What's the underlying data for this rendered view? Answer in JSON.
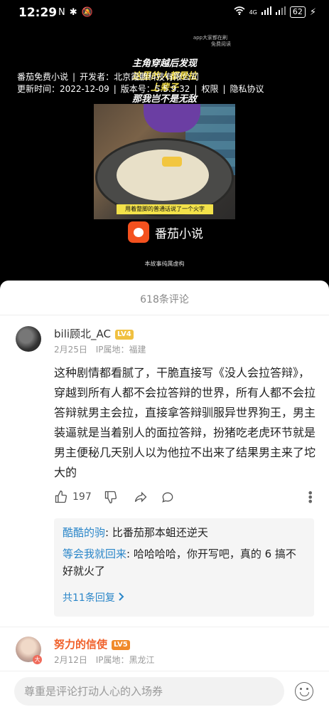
{
  "status_bar": {
    "time": "12:29",
    "left_icons": [
      "N",
      "✱",
      "🔕"
    ],
    "signal": "4G",
    "battery": "62"
  },
  "video": {
    "caption_line1": "主角穿越后发现",
    "caption_line2": "这里的人都是拉",
    "caption_line3": "上辈子",
    "caption_line4": "那我岂不是无敌",
    "subtitle": "用着蹩脚的普通话说了一个火字",
    "watermark1": "app大家都在刷",
    "watermark2": "免费阅读",
    "brand_name": "番茄小说",
    "brand_sub": "本故事纯属虚构",
    "app_info": {
      "app_name": "番茄免费小说",
      "developer": "开发者：北京霞鹏科技有限公司",
      "updated": "更新时间：2022-12-09",
      "version": "版本号：5.5.9.32",
      "permissions": "权限",
      "privacy": "隐私协议",
      "separator": "|"
    }
  },
  "comments": {
    "title": "618条评论",
    "items": [
      {
        "name": "bili顾北_AC",
        "level": "LV4",
        "date": "2月25日",
        "ip": "IP属地：福建",
        "body": "这种剧情都看腻了，干脆直接写《没人会拉答辩》，穿越到所有人都不会拉答辩的世界，所有人都不会拉答辩就男主会拉，直接拿答辩驯服异世界狗王，男主装逼就是当着别人的面拉答辩，扮猪吃老虎环节就是男主便秘几天别人以为他拉不出来了结果男主来了坨大的",
        "likes": "197"
      },
      {
        "name": "努力的信使",
        "level": "LV5",
        "date": "2月12日",
        "ip": "IP属地：黑龙江",
        "badge": "大"
      }
    ],
    "replies": [
      {
        "name": "酷酷的驹",
        "text": "比番茄那本蛆还逆天"
      },
      {
        "name": "等会我就回来",
        "text": "哈哈哈哈，你开写吧，真的 6 搞不好就火了"
      }
    ],
    "more_replies": "共11条回复",
    "input_placeholder": "尊重是评论打动人心的入场券"
  }
}
